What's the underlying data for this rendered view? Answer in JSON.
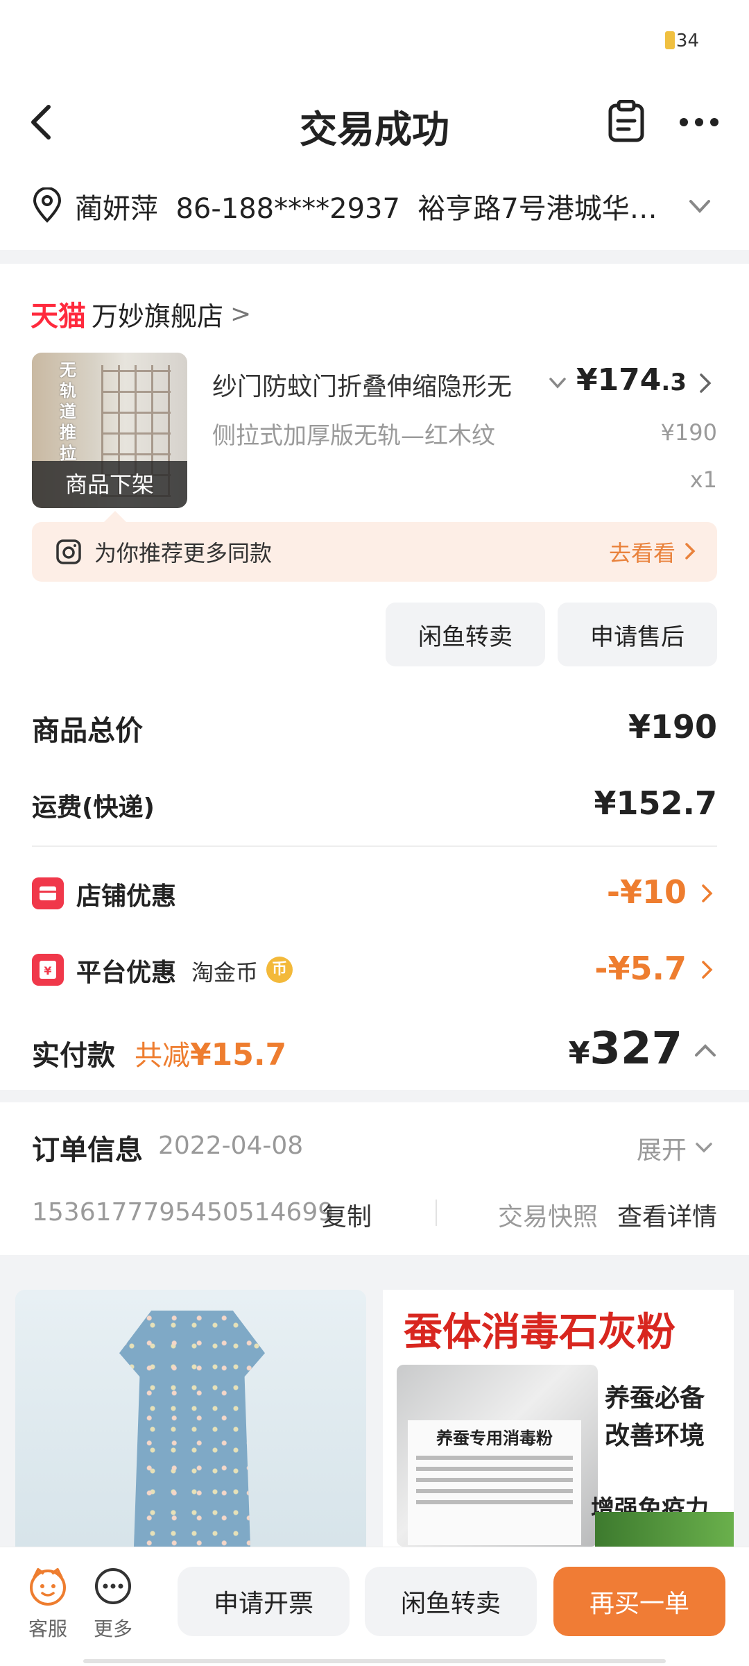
{
  "status_bar": {
    "battery": "34"
  },
  "header": {
    "title": "交易成功"
  },
  "address": {
    "name": "蔺妍萍",
    "phone": "86-188****2937",
    "location": "裕亨路7号港城华…"
  },
  "shop": {
    "platform": "天猫",
    "name": "万妙旗舰店",
    "arrow": ">"
  },
  "product": {
    "image_text": "无轨道推拉",
    "status": "商品下架",
    "title": "纱门防蚊门折叠伸缩隐形无",
    "price_main": "¥174",
    "price_decimal": ".3",
    "spec": "侧拉式加厚版无轨—红木纹",
    "original_price": "¥190",
    "qty": "x1"
  },
  "recommend": {
    "text": "为你推荐更多同款",
    "action": "去看看"
  },
  "actions": {
    "resell": "闲鱼转卖",
    "after_sale": "申请售后"
  },
  "summary": {
    "total_label": "商品总价",
    "total_value": "¥190",
    "shipping_label": "运费(快递)",
    "shipping_value": "¥152.7",
    "shop_discount_label": "店铺优惠",
    "shop_discount_value": "-¥10",
    "platform_discount_label": "平台优惠",
    "platform_discount_sub": "淘金币",
    "coin_glyph": "币",
    "platform_discount_value": "-¥5.7",
    "paid_label": "实付款",
    "saved_prefix": "共减",
    "saved_value": "¥15.7",
    "paid_currency": "¥",
    "paid_value": "327"
  },
  "order": {
    "title": "订单信息",
    "date": "2022-04-08",
    "expand": "展开",
    "number": "1536177795450514699",
    "copy": "复制",
    "snapshot": "交易快照",
    "detail": "查看详情"
  },
  "feed": {
    "ad2_title": "蚕体消毒石灰粉",
    "ad2_bag_label": "养蚕专用消毒粉",
    "ad2_line1": "养蚕必备",
    "ad2_line2": "改善环境",
    "ad2_line3": "增强免疫力"
  },
  "bottom_bar": {
    "service": "客服",
    "more": "更多",
    "invoice": "申请开票",
    "resell": "闲鱼转卖",
    "rebuy": "再买一单"
  },
  "colors": {
    "accent": "#F07C35",
    "tmall_red": "#FF2A3D",
    "discount": "#EE7D2F"
  }
}
